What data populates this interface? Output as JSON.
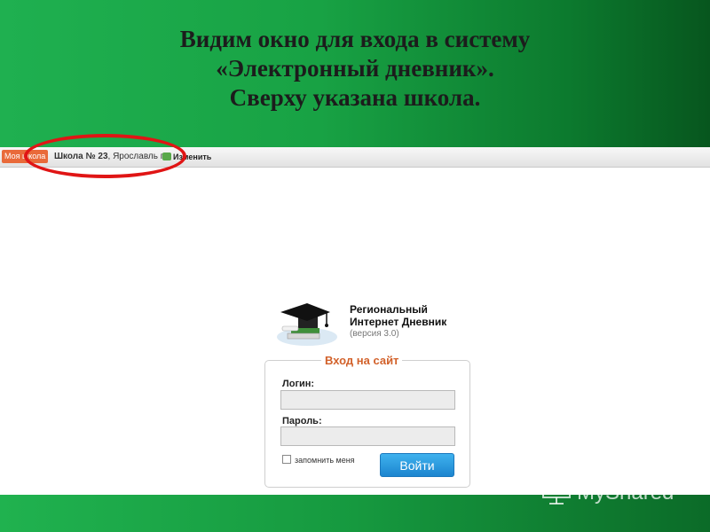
{
  "slide": {
    "title_lines": [
      "Видим окно для входа в систему",
      "«Электронный дневник».",
      "Сверху указана школа."
    ]
  },
  "topbar": {
    "my_school_tab": "Моя школа",
    "school_name_bold": "Школа № 23",
    "school_city": ", Ярославль г",
    "change_label": "Изменить"
  },
  "logo": {
    "title_line1": "Региональный",
    "title_line2": "Интернет Дневник",
    "version": "(версия 3.0)"
  },
  "login_form": {
    "legend": "Вход на сайт",
    "login_label": "Логин:",
    "login_value": "",
    "password_label": "Пароль:",
    "password_value": "",
    "remember_label": "запомнить меня",
    "submit_label": "Войти"
  },
  "watermark": {
    "text": "MyShared"
  },
  "colors": {
    "header_green": "#18a244",
    "annotation_red": "#e01515",
    "legend_orange": "#d2612a",
    "button_blue": "#2a9be0",
    "tab_orange": "#e96a3a"
  },
  "icons": {
    "logo": "graduation-cap-books-icon",
    "change": "refresh-icon",
    "watermark": "presentation-board-icon"
  }
}
